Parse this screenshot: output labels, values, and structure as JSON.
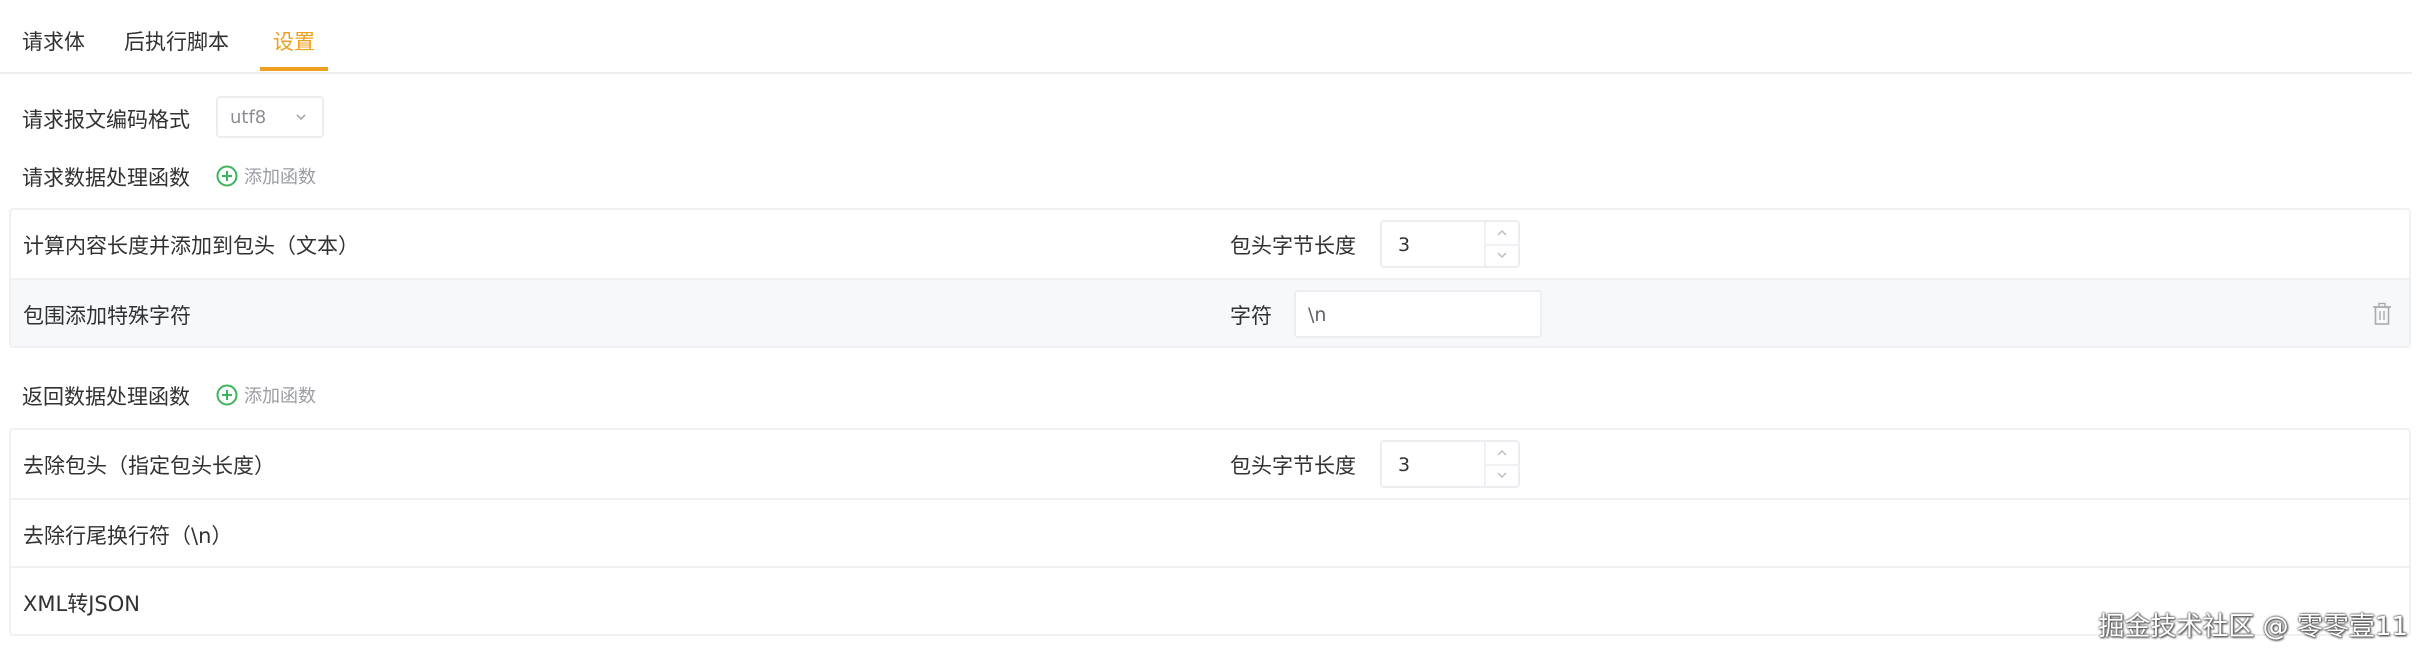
{
  "tabs": [
    {
      "label": "请求体"
    },
    {
      "label": "后执行脚本"
    },
    {
      "label": "设置",
      "active": true
    }
  ],
  "encoding": {
    "label": "请求报文编码格式",
    "value": "utf8"
  },
  "request_section": {
    "label": "请求数据处理函数",
    "add_label": "添加函数",
    "rows": [
      {
        "name": "计算内容长度并添加到包头（文本）",
        "param_label": "包头字节长度",
        "param_value": "3"
      },
      {
        "name": "包围添加特殊字符",
        "param_label": "字符",
        "param_value": "\\n"
      }
    ]
  },
  "response_section": {
    "label": "返回数据处理函数",
    "add_label": "添加函数",
    "rows": [
      {
        "name": "去除包头（指定包头长度）",
        "param_label": "包头字节长度",
        "param_value": "3"
      },
      {
        "name": "去除行尾换行符（\\n）"
      },
      {
        "name": "XML转JSON"
      }
    ]
  },
  "watermark": "掘金技术社区 @ 零零壹11",
  "colors": {
    "accent": "#f0a020",
    "add_icon": "#3cb45a"
  },
  "icons": {
    "add": "plus-circle-icon",
    "dropdown": "chevron-down-icon",
    "delete": "trash-icon",
    "stepper_up": "chevron-up-icon",
    "stepper_down": "chevron-down-icon"
  }
}
